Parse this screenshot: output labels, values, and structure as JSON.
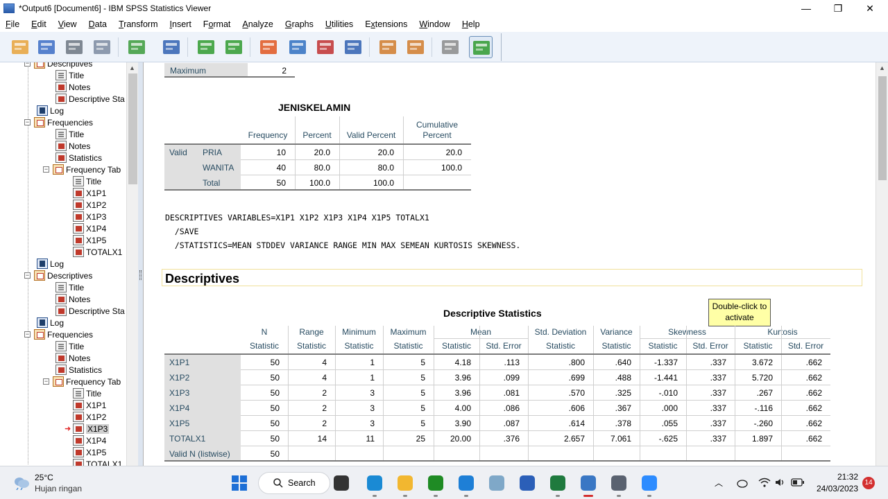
{
  "window": {
    "title": "*Output6 [Document6] - IBM SPSS Statistics Viewer",
    "controls": {
      "minimize": "—",
      "restore": "❐",
      "close": "✕"
    }
  },
  "menu": [
    {
      "label": "File",
      "u": "F",
      "rest": "ile"
    },
    {
      "label": "Edit",
      "u": "E",
      "rest": "dit"
    },
    {
      "label": "View",
      "u": "V",
      "rest": "iew"
    },
    {
      "label": "Data",
      "u": "D",
      "rest": "ata"
    },
    {
      "label": "Transform",
      "u": "T",
      "rest": "ransform"
    },
    {
      "label": "Insert",
      "u": "I",
      "rest": "nsert"
    },
    {
      "label": "Format",
      "u": "o",
      "pre": "F",
      "rest": "rmat"
    },
    {
      "label": "Analyze",
      "u": "A",
      "rest": "nalyze"
    },
    {
      "label": "Graphs",
      "u": "G",
      "rest": "raphs"
    },
    {
      "label": "Utilities",
      "u": "U",
      "rest": "tilities"
    },
    {
      "label": "Extensions",
      "u": "x",
      "pre": "E",
      "rest": "tensions"
    },
    {
      "label": "Window",
      "u": "W",
      "rest": "indow"
    },
    {
      "label": "Help",
      "u": "H",
      "rest": "elp"
    }
  ],
  "toolbar": [
    {
      "name": "open-icon",
      "color": "#e8a23a"
    },
    {
      "name": "save-icon",
      "color": "#3b6cc4"
    },
    {
      "name": "print-icon",
      "color": "#6b7480"
    },
    {
      "name": "print-preview-icon",
      "color": "#7b8aa0"
    },
    {
      "name": "export-icon",
      "color": "#3a9a3a"
    },
    {
      "name": "recall-dialog-icon",
      "color": "#2f5fb0"
    },
    {
      "name": "undo-icon",
      "color": "#2f9a2f"
    },
    {
      "name": "redo-icon",
      "color": "#2f9a2f"
    },
    {
      "name": "goto-data-icon",
      "color": "#e0551f"
    },
    {
      "name": "goto-case-icon",
      "color": "#2f6fc0"
    },
    {
      "name": "goto-variable-icon",
      "color": "#c02f2f"
    },
    {
      "name": "variables-icon",
      "color": "#2f5fb0"
    },
    {
      "name": "insert-output-icon",
      "color": "#d07a2a"
    },
    {
      "name": "designate-window-icon",
      "color": "#d07a2a"
    },
    {
      "name": "hide-icon",
      "color": "#8a8a8a"
    },
    {
      "name": "add-icon",
      "color": "#2f9a2f"
    }
  ],
  "outline": [
    {
      "text": "Descriptives",
      "level": 1,
      "icon": "book",
      "expander": "−"
    },
    {
      "text": "Title",
      "level": 2,
      "icon": "doc"
    },
    {
      "text": "Notes",
      "level": 2,
      "icon": "red"
    },
    {
      "text": "Descriptive Sta",
      "level": 2,
      "icon": "red"
    },
    {
      "text": "Log",
      "level": 1,
      "icon": "log"
    },
    {
      "text": "Frequencies",
      "level": 1,
      "icon": "book",
      "expander": "−"
    },
    {
      "text": "Title",
      "level": 2,
      "icon": "doc"
    },
    {
      "text": "Notes",
      "level": 2,
      "icon": "red"
    },
    {
      "text": "Statistics",
      "level": 2,
      "icon": "red"
    },
    {
      "text": "Frequency Tab",
      "level": 2,
      "icon": "book",
      "expander": "−"
    },
    {
      "text": "Title",
      "level": 3,
      "icon": "doc"
    },
    {
      "text": "X1P1",
      "level": 3,
      "icon": "red"
    },
    {
      "text": "X1P2",
      "level": 3,
      "icon": "red"
    },
    {
      "text": "X1P3",
      "level": 3,
      "icon": "red"
    },
    {
      "text": "X1P4",
      "level": 3,
      "icon": "red"
    },
    {
      "text": "X1P5",
      "level": 3,
      "icon": "red"
    },
    {
      "text": "TOTALX1",
      "level": 3,
      "icon": "red"
    },
    {
      "text": "Log",
      "level": 1,
      "icon": "log"
    },
    {
      "text": "Descriptives",
      "level": 1,
      "icon": "book",
      "expander": "−"
    },
    {
      "text": "Title",
      "level": 2,
      "icon": "doc"
    },
    {
      "text": "Notes",
      "level": 2,
      "icon": "red"
    },
    {
      "text": "Descriptive Sta",
      "level": 2,
      "icon": "red"
    },
    {
      "text": "Log",
      "level": 1,
      "icon": "log"
    },
    {
      "text": "Frequencies",
      "level": 1,
      "icon": "book",
      "expander": "−"
    },
    {
      "text": "Title",
      "level": 2,
      "icon": "doc"
    },
    {
      "text": "Notes",
      "level": 2,
      "icon": "red"
    },
    {
      "text": "Statistics",
      "level": 2,
      "icon": "red"
    },
    {
      "text": "Frequency Tab",
      "level": 2,
      "icon": "book",
      "expander": "−"
    },
    {
      "text": "Title",
      "level": 3,
      "icon": "doc"
    },
    {
      "text": "X1P1",
      "level": 3,
      "icon": "red"
    },
    {
      "text": "X1P2",
      "level": 3,
      "icon": "red"
    },
    {
      "text": "X1P3",
      "level": 3,
      "icon": "red",
      "selected": true
    },
    {
      "text": "X1P4",
      "level": 3,
      "icon": "red"
    },
    {
      "text": "X1P5",
      "level": 3,
      "icon": "red"
    },
    {
      "text": "TOTALX1",
      "level": 3,
      "icon": "red"
    }
  ],
  "top_table": {
    "label": "Maximum",
    "value": "2"
  },
  "freq_table": {
    "title": "JENISKELAMIN",
    "headers": [
      "Frequency",
      "Percent",
      "Valid Percent",
      "Cumulative\nPercent"
    ],
    "group_label": "Valid",
    "rows": [
      {
        "label": "PRIA",
        "values": [
          "10",
          "20.0",
          "20.0",
          "20.0"
        ]
      },
      {
        "label": "WANITA",
        "values": [
          "40",
          "80.0",
          "80.0",
          "100.0"
        ]
      },
      {
        "label": "Total",
        "values": [
          "50",
          "100.0",
          "100.0",
          ""
        ]
      }
    ]
  },
  "syntax": [
    "DESCRIPTIVES VARIABLES=X1P1 X1P2 X1P3 X1P4 X1P5 TOTALX1",
    "  /SAVE",
    "  /STATISTICS=MEAN STDDEV VARIANCE RANGE MIN MAX SEMEAN KURTOSIS SKEWNESS."
  ],
  "section_heading": "Descriptives",
  "tooltip": "Double-click to\nactivate",
  "desc_table": {
    "title": "Descriptive Statistics",
    "groups": [
      "N",
      "Range",
      "Minimum",
      "Maximum",
      "Mean",
      "Std. Deviation",
      "Variance",
      "Skewness",
      "Kurtosis"
    ],
    "subheaders": [
      "Statistic",
      "Statistic",
      "Statistic",
      "Statistic",
      "Statistic",
      "Std. Error",
      "Statistic",
      "Statistic",
      "Statistic",
      "Std. Error",
      "Statistic",
      "Std. Error"
    ],
    "rows": [
      {
        "label": "X1P1",
        "values": [
          "50",
          "4",
          "1",
          "5",
          "4.18",
          ".113",
          ".800",
          ".640",
          "-1.337",
          ".337",
          "3.672",
          ".662"
        ]
      },
      {
        "label": "X1P2",
        "values": [
          "50",
          "4",
          "1",
          "5",
          "3.96",
          ".099",
          ".699",
          ".488",
          "-1.441",
          ".337",
          "5.720",
          ".662"
        ]
      },
      {
        "label": "X1P3",
        "values": [
          "50",
          "2",
          "3",
          "5",
          "3.96",
          ".081",
          ".570",
          ".325",
          "-.010",
          ".337",
          ".267",
          ".662"
        ]
      },
      {
        "label": "X1P4",
        "values": [
          "50",
          "2",
          "3",
          "5",
          "4.00",
          ".086",
          ".606",
          ".367",
          ".000",
          ".337",
          "-.116",
          ".662"
        ]
      },
      {
        "label": "X1P5",
        "values": [
          "50",
          "2",
          "3",
          "5",
          "3.90",
          ".087",
          ".614",
          ".378",
          ".055",
          ".337",
          "-.260",
          ".662"
        ]
      },
      {
        "label": "TOTALX1",
        "values": [
          "50",
          "14",
          "11",
          "25",
          "20.00",
          ".376",
          "2.657",
          "7.061",
          "-.625",
          ".337",
          "1.897",
          ".662"
        ]
      },
      {
        "label": "Valid N (listwise)",
        "values": [
          "50",
          "",
          "",
          "",
          "",
          "",
          "",
          "",
          "",
          "",
          "",
          ""
        ]
      }
    ]
  },
  "taskbar": {
    "weather_temp": "25°C",
    "weather_desc": "Hujan ringan",
    "search_label": "Search",
    "time": "21:32",
    "date": "24/03/2023",
    "notification_count": "14",
    "apps": [
      {
        "name": "start-icon",
        "color": "#1d6fd6"
      },
      {
        "name": "task-view-icon",
        "color": "#333333"
      },
      {
        "name": "edge-icon",
        "color": "#1a8ad4"
      },
      {
        "name": "file-explorer-icon",
        "color": "#f2b730"
      },
      {
        "name": "xbox-icon",
        "color": "#1f8b24"
      },
      {
        "name": "store-icon",
        "color": "#1e7fd6"
      },
      {
        "name": "cortana-icon",
        "color": "#7fa8c8"
      },
      {
        "name": "word-icon",
        "color": "#2b5fb8"
      },
      {
        "name": "excel-icon",
        "color": "#1f7a3e"
      },
      {
        "name": "spss-icon",
        "color": "#3a77c4"
      },
      {
        "name": "settings-icon",
        "color": "#5a6270"
      },
      {
        "name": "zoom-icon",
        "color": "#2d8cff"
      }
    ]
  }
}
